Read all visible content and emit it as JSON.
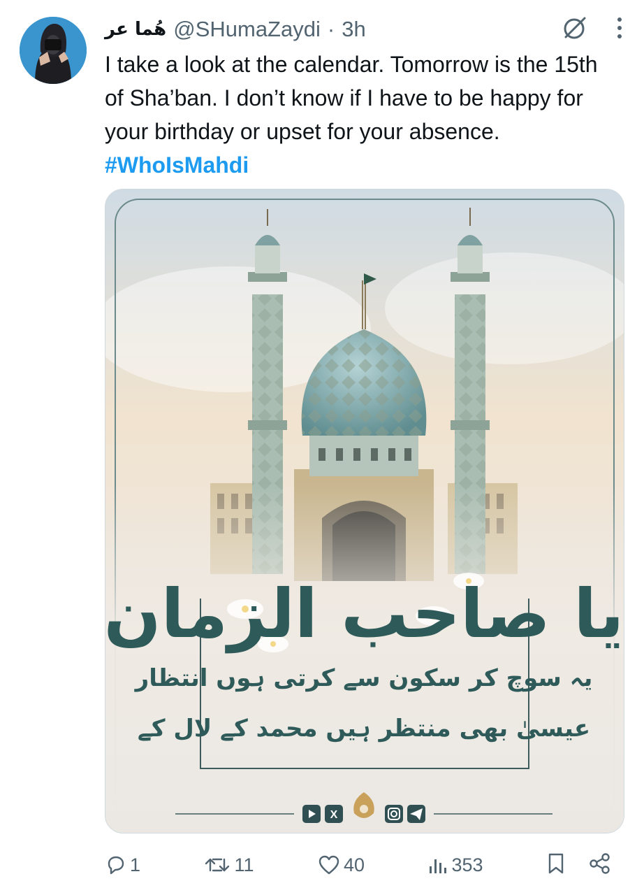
{
  "author": {
    "display_name": "هُما عر",
    "handle": "@SHumaZaydi",
    "separator": "·",
    "time": "3h"
  },
  "tweet": {
    "text": "I take a look at the calendar. Tomorrow is the 15th of Sha’ban. I don’t know if I have to be happy for your birthday or upset for your absence. ",
    "hashtag": "#WhoIsMahdi"
  },
  "media": {
    "title_calligraphy": "یا صاحب الزمان",
    "line1": "یہ سوچ کر سکون سے کرتی ہوں انتظار",
    "line2": "عیسیٰ بھی منتظر ہیں محمد کے لال کے",
    "social_icons": [
      "youtube-icon",
      "x-icon",
      "instagram-icon",
      "telegram-icon"
    ],
    "x_glyph": "X"
  },
  "stats": {
    "replies": "1",
    "reposts": "11",
    "likes": "40",
    "views": "353"
  },
  "colors": {
    "accent": "#1d9bf0",
    "muted": "#536471",
    "calligraphy": "#2f5a5a"
  }
}
